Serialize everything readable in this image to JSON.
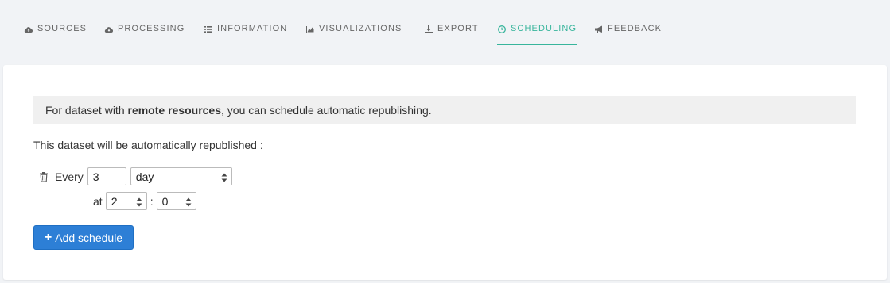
{
  "tabs": [
    {
      "label": "SOURCES",
      "icon": "cloud-upload-icon",
      "active": false
    },
    {
      "label": "PROCESSING",
      "icon": "cloud-cog-icon",
      "active": false
    },
    {
      "label": "INFORMATION",
      "icon": "list-icon",
      "active": false
    },
    {
      "label": "VISUALIZATIONS",
      "icon": "area-chart-icon",
      "active": false
    },
    {
      "label": "EXPORT",
      "icon": "download-icon",
      "active": false
    },
    {
      "label": "SCHEDULING",
      "icon": "clock-icon",
      "active": true
    },
    {
      "label": "FEEDBACK",
      "icon": "bullhorn-icon",
      "active": false
    }
  ],
  "colors": {
    "accent": "#38b59c",
    "primary_button": "#2d7fd6",
    "background": "#f1f3f6"
  },
  "notice": {
    "prefix": "For dataset with ",
    "bold": "remote resources",
    "suffix": ", you can schedule automatic republishing."
  },
  "intro": "This dataset will be automatically republished :",
  "schedule": {
    "every_label": "Every",
    "interval_value": "3",
    "unit_value": "day",
    "at_label": "at",
    "hour_value": "2",
    "separator": ":",
    "minute_value": "0"
  },
  "add_button": {
    "plus": "+",
    "label": "Add schedule"
  }
}
